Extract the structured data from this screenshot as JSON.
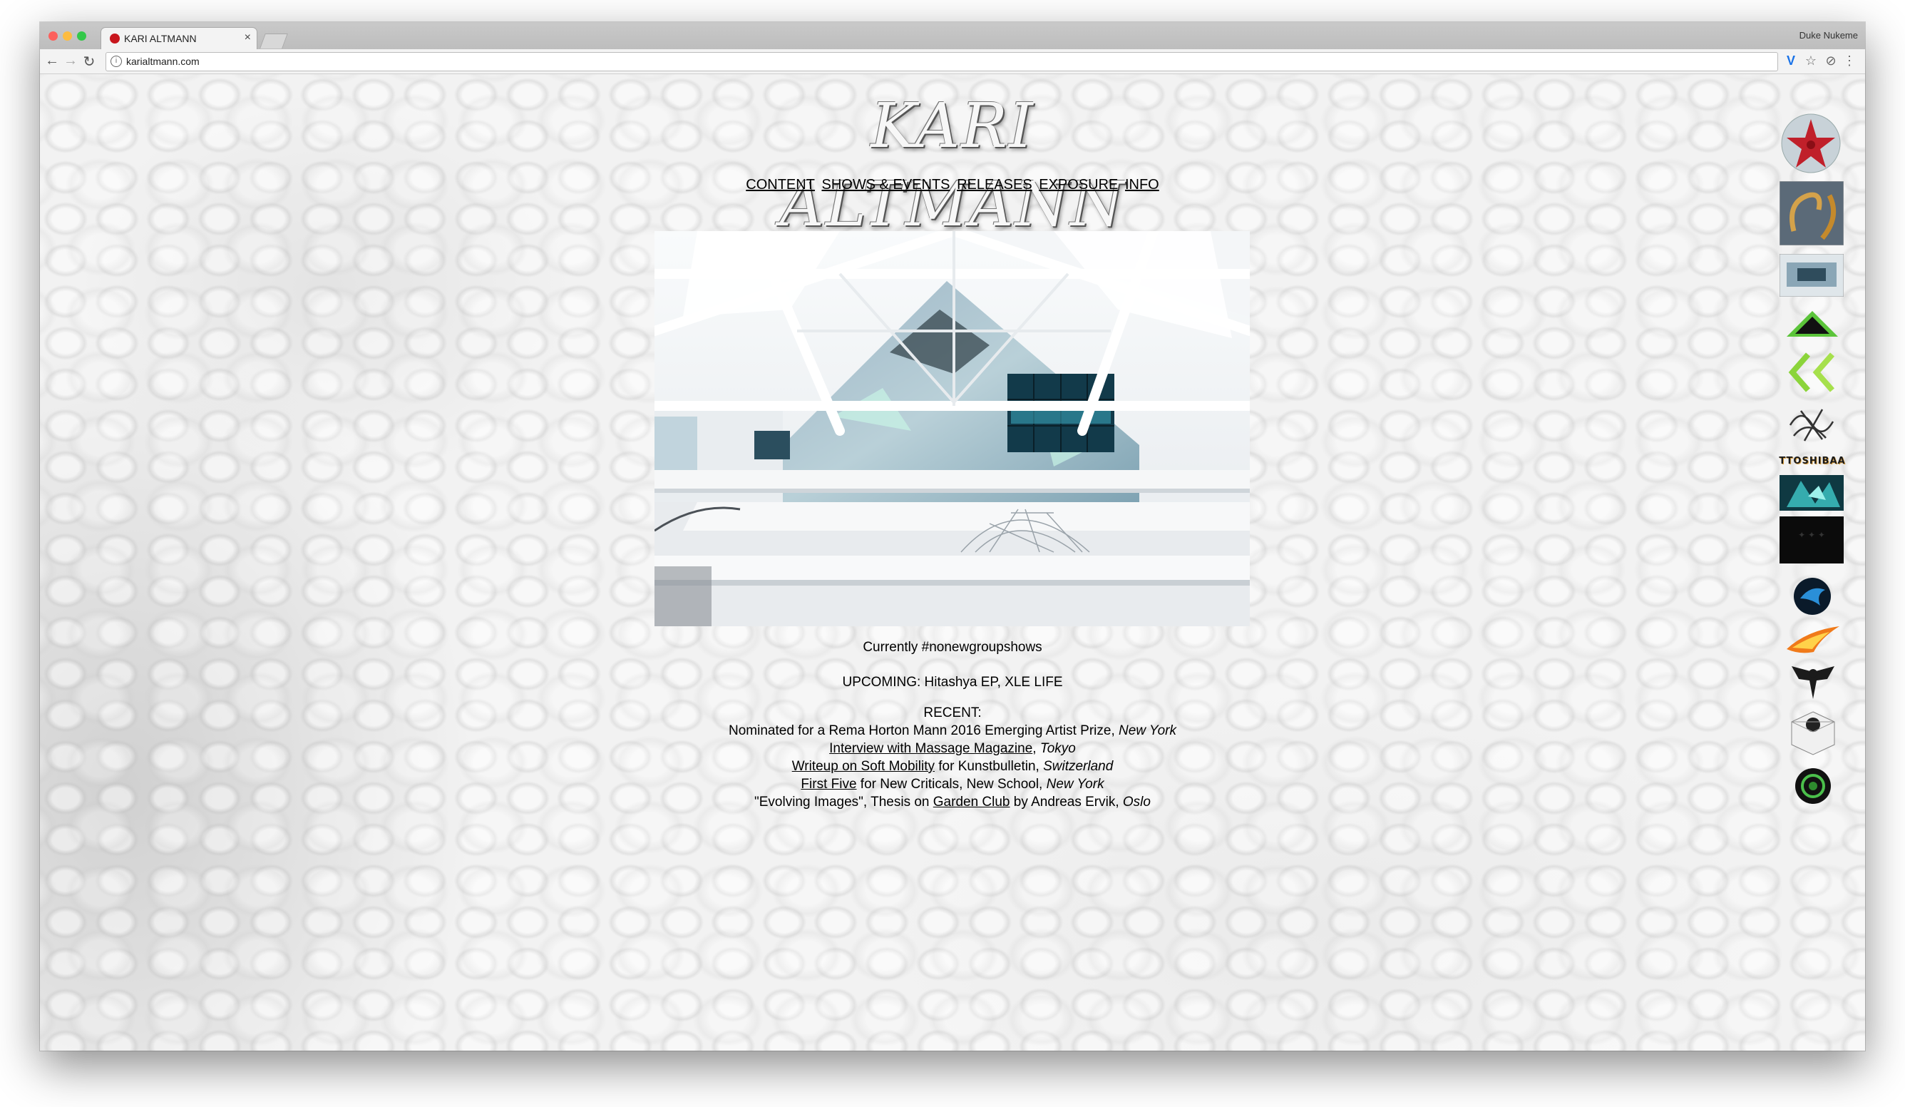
{
  "browser": {
    "tab_title": "KARI ALTMANN",
    "profile_name": "Duke Nukeme",
    "url": "karialtmann.com",
    "traffic_lights": [
      "#fc605c",
      "#fdbc40",
      "#34c84a"
    ]
  },
  "site": {
    "logo_text": "KARI ALTMANN",
    "nav": [
      {
        "label": "CONTENT"
      },
      {
        "label": "SHOWS & EVENTS"
      },
      {
        "label": "RELEASES"
      },
      {
        "label": "EXPOSURE"
      },
      {
        "label": "INFO"
      }
    ],
    "currently": "Currently #nonewgroupshows",
    "upcoming": "UPCOMING: Hitashya EP, XLE LIFE",
    "recent_heading": "RECENT:",
    "recent": [
      {
        "pre": "Nominated for a Rema Horton Mann 2016 Emerging Artist Prize, ",
        "link": "",
        "post": "",
        "place": "New York"
      },
      {
        "pre": "",
        "link": "Interview with Massage Magazine",
        "post": ", ",
        "place": "Tokyo"
      },
      {
        "pre": "",
        "link": "Writeup on Soft Mobility",
        "post": " for Kunstbulletin, ",
        "place": "Switzerland"
      },
      {
        "pre": "",
        "link": "First Five",
        "post": " for New Criticals, New School, ",
        "place": "New York"
      },
      {
        "pre": "\"Evolving Images\", Thesis on ",
        "link": "Garden Club",
        "post": " by Andreas Ervik, ",
        "place": "Oslo"
      }
    ],
    "sidebar_icons": [
      "starfish-icon",
      "golden-hooks-icon",
      "gallery-room-icon",
      "green-pyramid-icon",
      "green-arrows-icon",
      "scribble-icon",
      "ttoshibaa-logo",
      "teal-crystal-icon",
      "dark-text-icon",
      "blue-bird-icon",
      "fire-swoosh-icon",
      "eagle-emblem-icon",
      "white-box-icon",
      "green-circle-icon"
    ],
    "sidebar_ttoshibaa_text": "TTOSHIBAA"
  }
}
